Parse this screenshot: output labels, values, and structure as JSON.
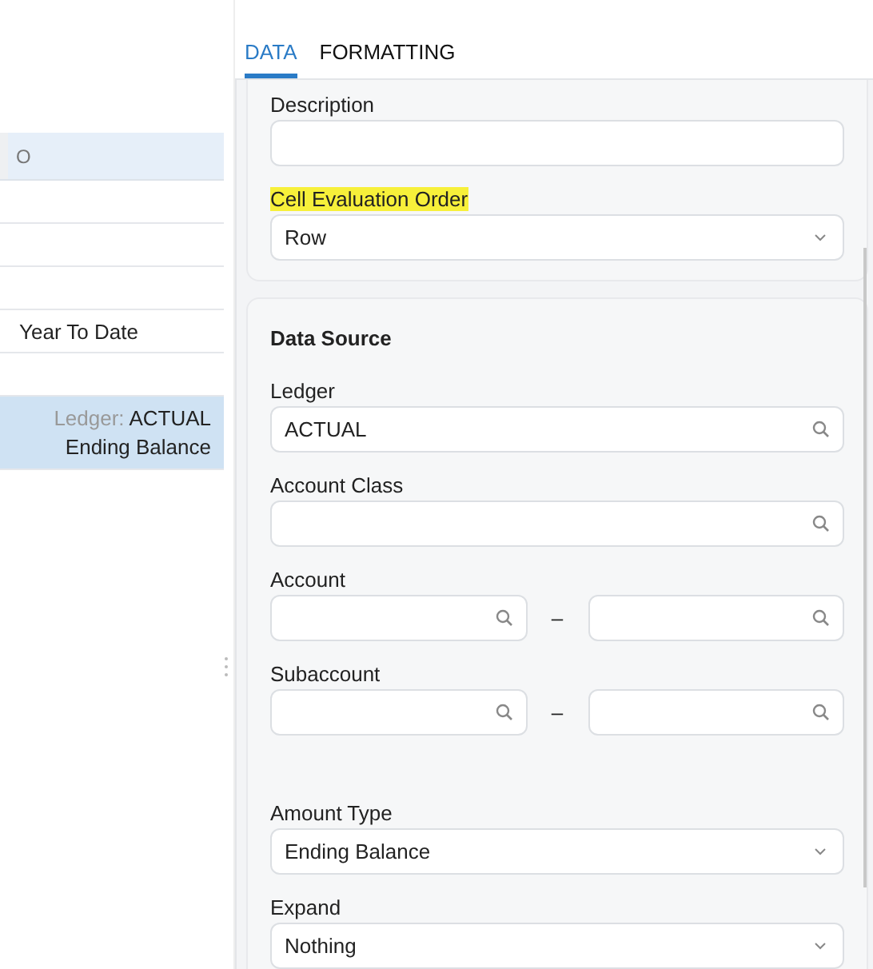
{
  "grid": {
    "header_cell": "O",
    "rows": [
      {
        "kind": "plain",
        "selected": false
      },
      {
        "kind": "plain",
        "selected": false
      },
      {
        "kind": "plain",
        "selected": false
      },
      {
        "kind": "plain",
        "selected": false,
        "text": "Year To Date"
      },
      {
        "kind": "plain",
        "selected": false
      },
      {
        "kind": "source",
        "selected": true,
        "label": "Ledger:",
        "value": "ACTUAL",
        "line_2": "Ending Balance"
      }
    ]
  },
  "tabs": [
    {
      "label": "DATA",
      "selected": true
    },
    {
      "label": "FORMATTING",
      "selected": false
    }
  ],
  "general": {
    "fields": [
      {
        "kind": "text",
        "label": "Description",
        "highlighted": false
      },
      {
        "kind": "select",
        "label": "Cell Evaluation Order",
        "highlighted": true,
        "value": "Row"
      }
    ]
  },
  "data_source": {
    "title": "Data Source",
    "fields": [
      {
        "kind": "lookup",
        "label": "Ledger",
        "highlighted": false,
        "value": "ACTUAL"
      },
      {
        "kind": "lookup",
        "label": "Account Class",
        "highlighted": false
      },
      {
        "kind": "range",
        "label": "Account",
        "highlighted": false,
        "separator": "–"
      },
      {
        "kind": "range",
        "label": "Subaccount",
        "highlighted": false,
        "separator": "–"
      }
    ],
    "options": [
      {
        "kind": "select",
        "label": "Amount Type",
        "highlighted": false,
        "value": "Ending Balance"
      },
      {
        "kind": "select",
        "label": "Expand",
        "highlighted": false,
        "value": "Nothing"
      }
    ]
  }
}
